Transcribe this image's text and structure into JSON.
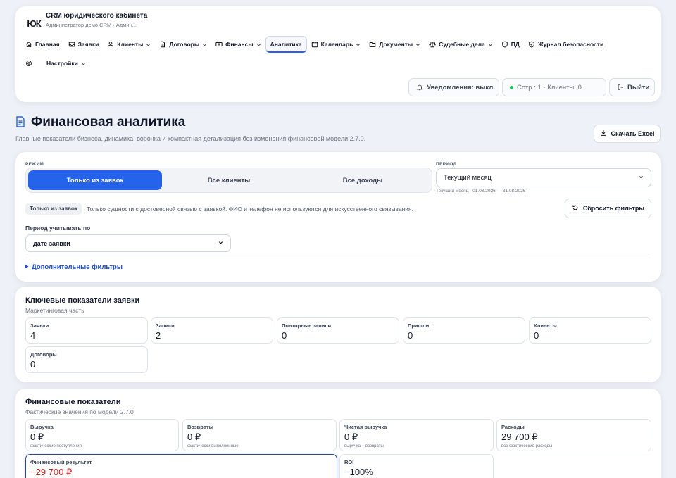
{
  "app": {
    "logo": "ЮК",
    "title": "CRM юридического кабинета",
    "subtitle": "Администратор демо CRM · Админ..."
  },
  "nav": {
    "items": [
      {
        "label": "Главная",
        "icon": "home-icon"
      },
      {
        "label": "Заявки",
        "icon": "inbox-icon"
      },
      {
        "label": "Клиенты",
        "icon": "user-icon"
      },
      {
        "label": "Договоры",
        "icon": "document-icon"
      },
      {
        "label": "Финансы",
        "icon": "money-icon"
      },
      {
        "label": "Аналитика",
        "icon": ""
      },
      {
        "label": "Календарь",
        "icon": "calendar-icon"
      },
      {
        "label": "Документы",
        "icon": "folder-icon"
      },
      {
        "label": "Судебные дела",
        "icon": "scales-icon"
      },
      {
        "label": "ПД",
        "icon": "shield-icon"
      },
      {
        "label": "Журнал безопасности",
        "icon": "shield-check-icon"
      }
    ],
    "settings_label": "Настройки"
  },
  "header_actions": {
    "notifications": "Уведомления: выкл.",
    "stats": "Сотр.: 1 · Клиенты: 0",
    "logout": "Выйти"
  },
  "page": {
    "title": "Финансовая аналитика",
    "description": "Главные показатели бизнеса, динамика, воронка и компактная детализация без изменения финансовой модели 2.7.0.",
    "excel_button": "Скачать Excel"
  },
  "filters": {
    "mode_label": "РЕЖИМ",
    "modes": [
      "Только из заявок",
      "Все клиенты",
      "Все доходы"
    ],
    "period_label": "ПЕРИОД",
    "period_value": "Текущий месяц",
    "period_hint": "Текущий месяц · 01.08.2026 — 31.08.2026",
    "chip": "Только из заявок",
    "chip_desc": "Только сущности с достоверной связью с заявкой. ФИО и телефон не используются для искусственного связывания.",
    "reset_button": "Сбросить фильтры",
    "period_basis_label": "Период учитывать по",
    "period_basis_value": "дате заявки",
    "more_filters": "Дополнительные фильтры"
  },
  "kpi": {
    "title": "Ключевые показатели заявки",
    "subtitle": "Маркетинговая часть",
    "tiles": [
      {
        "label": "Заявки",
        "value": "4"
      },
      {
        "label": "Записи",
        "value": "2"
      },
      {
        "label": "Повторные записи",
        "value": "0"
      },
      {
        "label": "Пришли",
        "value": "0"
      },
      {
        "label": "Клиенты",
        "value": "0"
      },
      {
        "label": "Договоры",
        "value": "0"
      }
    ]
  },
  "finance": {
    "title": "Финансовые показатели",
    "subtitle": "Фактические значения по модели 2.7.0",
    "tiles": [
      {
        "label": "Выручка",
        "value": "0 ₽",
        "note": "фактические поступления"
      },
      {
        "label": "Возвраты",
        "value": "0 ₽",
        "note": "фактически выполненные"
      },
      {
        "label": "Чистая выручка",
        "value": "0 ₽",
        "note": "выручка − возвраты"
      },
      {
        "label": "Расходы",
        "value": "29 700 ₽",
        "note": "все фактические расходы"
      },
      {
        "label": "Финансовый результат",
        "value": "−29 700 ₽"
      },
      {
        "label": "ROI",
        "value": "−100%"
      }
    ]
  },
  "colors": {
    "accent": "#2563eb",
    "negative": "#c81e1e",
    "status_dot": "#22c55e"
  }
}
